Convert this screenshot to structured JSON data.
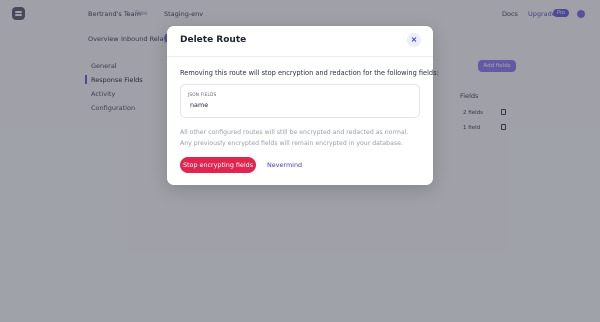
{
  "header": {
    "team_name": "Bertrand's Team",
    "plan": "Free",
    "environment": "Staging-env",
    "docs_link": "Docs",
    "upgrade_link": "Upgrade",
    "pro_badge": "Pro"
  },
  "tabs": [
    "Overview",
    "Inbound Relay"
  ],
  "sidebar": {
    "items": [
      {
        "label": "General"
      },
      {
        "label": "Response Fields",
        "active": true
      },
      {
        "label": "Activity"
      },
      {
        "label": "Configuration"
      }
    ]
  },
  "main": {
    "add_fields_button": "Add fields",
    "fields_heading": "Fields",
    "rows": [
      "2 fields",
      "1 field"
    ]
  },
  "modal": {
    "title": "Delete Route",
    "close_icon": "×",
    "description": "Removing this route will stop encryption and redaction for the following fields:",
    "json_fields_label": "JSON FIELDS",
    "json_fields_value": "name",
    "note": "All other configured routes will still be encrypted and redacted as normal. Any previously encrypted fields will remain encrypted in your database.",
    "confirm_button": "Stop encrypting fields",
    "cancel_button": "Nevermind"
  },
  "colors": {
    "accent": "#6a5fd8",
    "danger": "#e0264e",
    "link": "#4536c9"
  },
  "icons": {
    "logo": "brand-logo-icon",
    "close": "close-icon",
    "delete": "trash-icon",
    "avatar": "user-avatar"
  }
}
